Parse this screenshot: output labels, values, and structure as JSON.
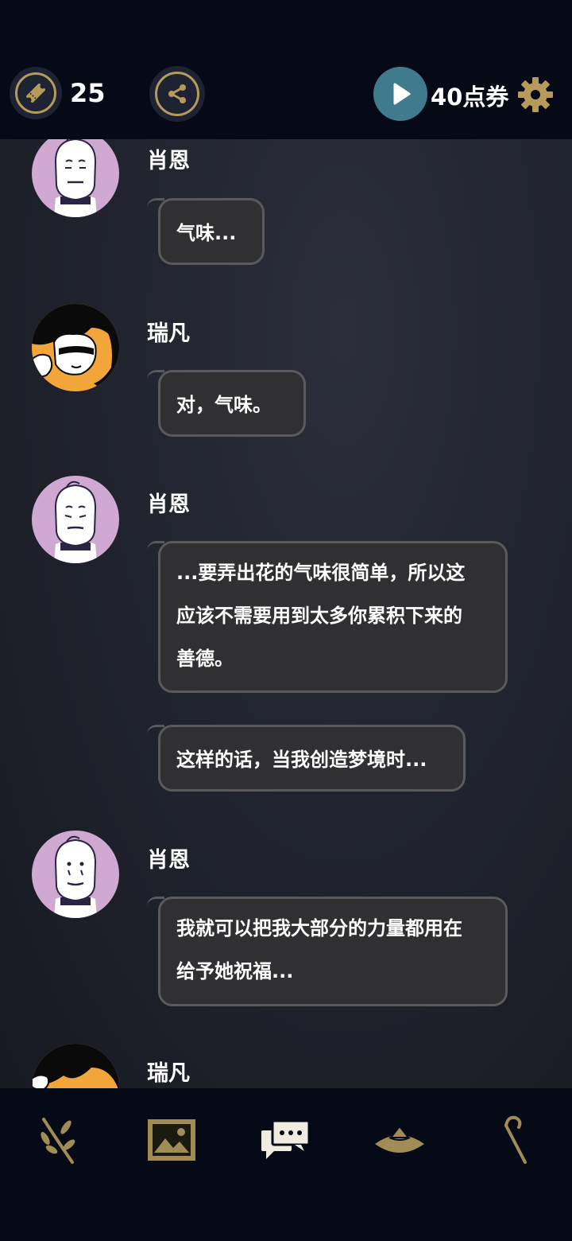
{
  "topbar": {
    "ticket_count": "25",
    "coupon_label": "40点券"
  },
  "messages": [
    {
      "speaker": "肖恩",
      "lines": [
        "气味..."
      ]
    },
    {
      "speaker": "瑞凡",
      "lines": [
        "对，气味。"
      ]
    },
    {
      "speaker": "肖恩",
      "lines": [
        "...要弄出花的气味很简单，所以这",
        "应该不需要用到太多你累积下来的",
        "善德。"
      ]
    },
    {
      "speaker": "",
      "lines": [
        "这样的话，当我创造梦境时..."
      ]
    },
    {
      "speaker": "肖恩",
      "lines": [
        "我就可以把我大部分的力量都用在",
        "给予她祝福..."
      ]
    },
    {
      "speaker": "瑞凡",
      "lines": []
    }
  ],
  "colors": {
    "accent_gold": "#b59a5a",
    "play_teal": "#3f7b8c",
    "bubble_bg": "#303032",
    "shaun_avatar_bg": "#cfa9d2",
    "raven_avatar_bg": "#f2a63a"
  },
  "icons": {
    "ticket": "ticket-icon",
    "share": "share-icon",
    "play": "play-icon",
    "settings": "gear-icon",
    "nav": [
      "olive-branch-icon",
      "gallery-icon",
      "chat-icon",
      "hat-icon",
      "cane-icon"
    ]
  }
}
